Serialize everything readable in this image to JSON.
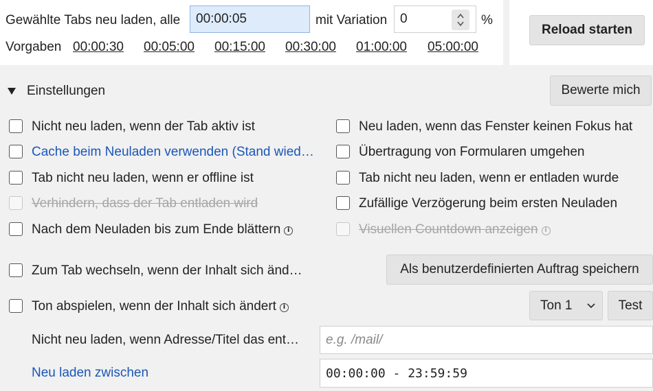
{
  "reload": {
    "prefix_label": "Gewählte Tabs neu laden, alle",
    "interval_value": "00:00:05",
    "variation_label": "mit Variation",
    "variation_value": "0",
    "percent_label": "%",
    "start_button": "Reload starten"
  },
  "presets": {
    "label": "Vorgaben",
    "items": [
      "00:00:30",
      "00:05:00",
      "00:15:00",
      "00:30:00",
      "01:00:00",
      "05:00:00"
    ]
  },
  "settings": {
    "toggle_label": "Einstellungen",
    "rate_button": "Bewerte mich"
  },
  "options": {
    "not_reload_active": {
      "label": "Nicht neu laden, wenn der Tab aktiv ist",
      "checked": false
    },
    "reload_no_focus": {
      "label": "Neu laden, wenn das Fenster keinen Fokus hat",
      "checked": false
    },
    "use_cache": {
      "label": "Cache beim Neuladen verwenden (Stand wied…",
      "checked": false
    },
    "bypass_forms": {
      "label": "Übertragung von Formularen umgehen",
      "checked": false
    },
    "not_reload_offline": {
      "label": "Tab nicht neu laden, wenn er offline ist",
      "checked": false
    },
    "not_reload_discarded": {
      "label": "Tab nicht neu laden, wenn er entladen wurde",
      "checked": false
    },
    "prevent_discard": {
      "label": "Verhindern, dass der Tab entladen wird",
      "checked": false,
      "disabled": true
    },
    "random_delay": {
      "label": "Zufällige Verzögerung beim ersten Neuladen",
      "checked": false
    },
    "scroll_to_end": {
      "label": "Nach dem Neuladen bis zum Ende blättern",
      "checked": false
    },
    "visual_countdown": {
      "label": "Visuellen Countdown anzeigen",
      "checked": false,
      "disabled": true
    },
    "switch_on_change": {
      "label": "Zum Tab wechseln, wenn der Inhalt sich änd…",
      "checked": false
    },
    "play_sound": {
      "label": "Ton abspielen, wenn der Inhalt sich ändert",
      "checked": false
    }
  },
  "custom_job_button": "Als benutzerdefinierten Auftrag speichern",
  "sound": {
    "selected": "Ton 1",
    "test_button": "Test"
  },
  "filter": {
    "label": "Nicht neu laden, wenn Adresse/Titel das ent…",
    "placeholder": "e.g. /mail/"
  },
  "time_range": {
    "label": "Neu laden zwischen",
    "value": "00:00:00 - 23:59:59"
  },
  "icons": {
    "info": "info-circle-icon",
    "expand": "triangle-down-icon",
    "spinner": "spinner-arrows-icon",
    "select": "chevron-down-icon"
  },
  "colors": {
    "link": "#1a56b8",
    "active_input": "#ddebfb",
    "disabled_text": "#a6a6a6"
  }
}
